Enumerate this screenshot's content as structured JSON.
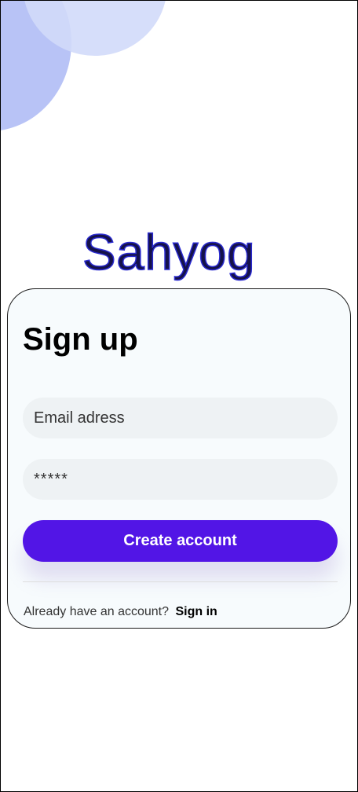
{
  "brand": {
    "name": "Sahyog"
  },
  "signup": {
    "title": "Sign up",
    "email_placeholder": "Email adress",
    "password_value": "*****",
    "submit_label": "Create account",
    "footer_prompt": "Already have an account?",
    "footer_link": "Sign in"
  },
  "colors": {
    "primary": "#5215e6",
    "field_bg": "#eef2f4",
    "card_bg": "#f7fbfd",
    "brand_text": "#15124a",
    "decor_circle_1": "#abb8f5",
    "decor_circle_2": "#d2dafa"
  }
}
